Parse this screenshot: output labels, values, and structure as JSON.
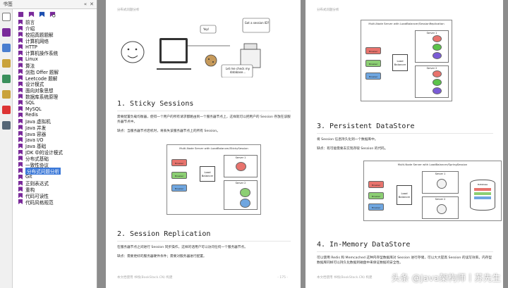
{
  "panel": {
    "title": "书签",
    "btn_collapse": "«",
    "btn_close": "✕"
  },
  "tree_items": [
    {
      "label": "前言",
      "selected": false
    },
    {
      "label": "介绍",
      "selected": false
    },
    {
      "label": "校招真题题解",
      "selected": false
    },
    {
      "label": "计算机网络",
      "selected": false
    },
    {
      "label": "HTTP",
      "selected": false
    },
    {
      "label": "计算机操作系统",
      "selected": false
    },
    {
      "label": "Linux",
      "selected": false
    },
    {
      "label": "算法",
      "selected": false
    },
    {
      "label": "剑指 Offer 题解",
      "selected": false
    },
    {
      "label": "Leetcode 题解",
      "selected": false
    },
    {
      "label": "设计模式",
      "selected": false
    },
    {
      "label": "面向对象思想",
      "selected": false
    },
    {
      "label": "数据库系统原理",
      "selected": false
    },
    {
      "label": "SQL",
      "selected": false
    },
    {
      "label": "MySQL",
      "selected": false
    },
    {
      "label": "Redis",
      "selected": false
    },
    {
      "label": "Java 虚拟机",
      "selected": false
    },
    {
      "label": "Java 并发",
      "selected": false
    },
    {
      "label": "Java 容器",
      "selected": false
    },
    {
      "label": "Java I/O",
      "selected": false
    },
    {
      "label": "Java 基础",
      "selected": false
    },
    {
      "label": "JDK 中的设计模式",
      "selected": false
    },
    {
      "label": "分布式基础",
      "selected": false
    },
    {
      "label": "一致性协议",
      "selected": false
    },
    {
      "label": "分布式问题分析",
      "selected": true
    },
    {
      "label": "Git",
      "selected": false
    },
    {
      "label": "正则表达式",
      "selected": false
    },
    {
      "label": "重构",
      "selected": false
    },
    {
      "label": "代码可读性",
      "selected": false
    },
    {
      "label": "代码风格规范",
      "selected": false
    }
  ],
  "page1": {
    "header": "分布式问题分析",
    "cartoon": {
      "yep": "Yep!",
      "got_session": "Got a session ID?",
      "check_db": "Let me check my database..."
    },
    "sec1_title": "1. Sticky Sessions",
    "sec1_p1": "需要配置负载均衡器，使得一个用户的所有请求都路由到一个服务器节点上，这样就可以把用户的 Session 存放在该服务器节点中。",
    "sec1_p2": "缺点：当服务器节点宕机时，将丢失该服务器节点上的所有 Session。",
    "diagram_title": "Multi-Node Server with LoadBalancer/StickySession",
    "lb_label": "Load Balancer",
    "server1": "Server 1",
    "server2": "Server 2",
    "browser": "Browser",
    "sec2_title": "2. Session Replication",
    "sec2_p1": "在服务器节点之间进行 Session 同步操作，这样的话用户可以访问任何一个服务器节点。",
    "sec2_p2": "缺点：需要更好的服务器硬件条件；需要对服务器进行配置。",
    "footer": "本文档使用 书栈(BookStack.CN) 构建",
    "page_num": "- 175 -"
  },
  "page2": {
    "header": "分布式问题分析",
    "diagram_title": "Multi-Node Server with LoadBalancer/SessionReplication",
    "sec3_title": "3. Persistent DataStore",
    "sec3_p1": "将 Session 信息持久化到一个数据库中。",
    "sec3_p2": "缺点：有可能需要去实现存取 Session 的代码。",
    "diagram2_title": "Multi-Node Server with LoadBalancer/SpringSession",
    "database": "Database",
    "sec4_title": "4. In-Memory DataStore",
    "sec4_p1": "可以使用 Redis 和 Memcached 这种内存型数据库对 Session 进行存储，可以大大提高 Session 的读写效率。内存型数据库同样可以持久化数据到磁盘中来保证数据的安全性。",
    "footer": "本文档使用 书栈(BookStack.CN) 构建"
  },
  "watermark": "头条 @Java架构师丨苏先生",
  "colors": {
    "browser_red": "#e8736d",
    "browser_green": "#8ccf73",
    "browser_blue": "#6fa6e0",
    "session_green": "#5cc34a",
    "session_purple": "#7a5bd6",
    "selection": "#3b78d8",
    "bookmark": "#7a2a9a"
  }
}
